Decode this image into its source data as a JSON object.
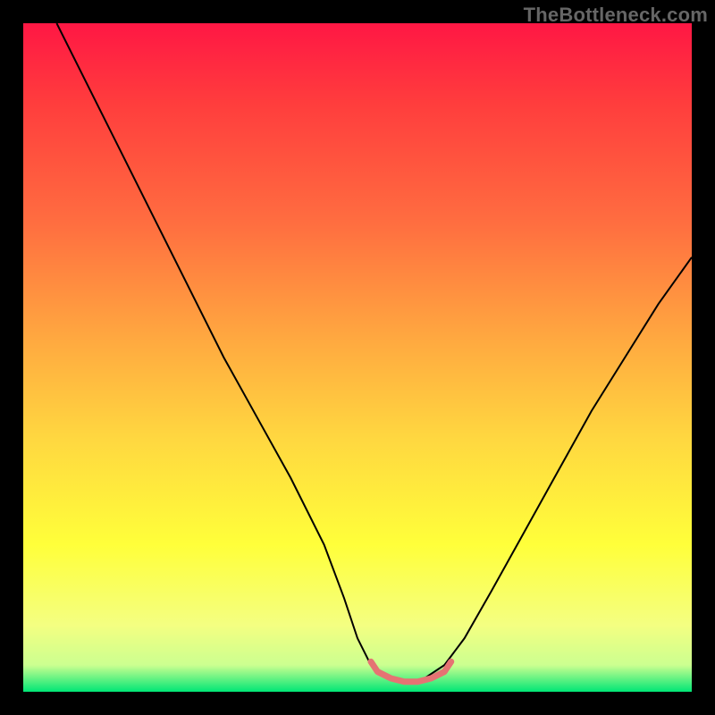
{
  "watermark": "TheBottleneck.com",
  "chart_data": {
    "type": "line",
    "title": "",
    "xlabel": "",
    "ylabel": "",
    "xlim": [
      0,
      100
    ],
    "ylim": [
      0,
      100
    ],
    "background_gradient_stops": [
      {
        "offset": 0.0,
        "color": "#ff1744"
      },
      {
        "offset": 0.12,
        "color": "#ff3d3d"
      },
      {
        "offset": 0.3,
        "color": "#ff6e40"
      },
      {
        "offset": 0.48,
        "color": "#ffab40"
      },
      {
        "offset": 0.62,
        "color": "#ffd740"
      },
      {
        "offset": 0.78,
        "color": "#ffff3a"
      },
      {
        "offset": 0.9,
        "color": "#f4ff81"
      },
      {
        "offset": 0.96,
        "color": "#ccff90"
      },
      {
        "offset": 1.0,
        "color": "#00e676"
      }
    ],
    "series": [
      {
        "name": "bottleneck-curve",
        "color": "#000000",
        "width": 2,
        "x": [
          5,
          10,
          15,
          20,
          25,
          30,
          35,
          40,
          45,
          48,
          50,
          52,
          55,
          58,
          60,
          63,
          66,
          70,
          75,
          80,
          85,
          90,
          95,
          100
        ],
        "y": [
          100,
          90,
          80,
          70,
          60,
          50,
          41,
          32,
          22,
          14,
          8,
          4,
          2,
          1.5,
          2,
          4,
          8,
          15,
          24,
          33,
          42,
          50,
          58,
          65
        ]
      },
      {
        "name": "sweet-spot-marker",
        "color": "#e57373",
        "width": 7,
        "x": [
          52,
          53,
          55,
          57,
          59,
          61,
          63,
          64
        ],
        "y": [
          4.5,
          3,
          2,
          1.5,
          1.5,
          2,
          3,
          4.5
        ]
      }
    ]
  }
}
